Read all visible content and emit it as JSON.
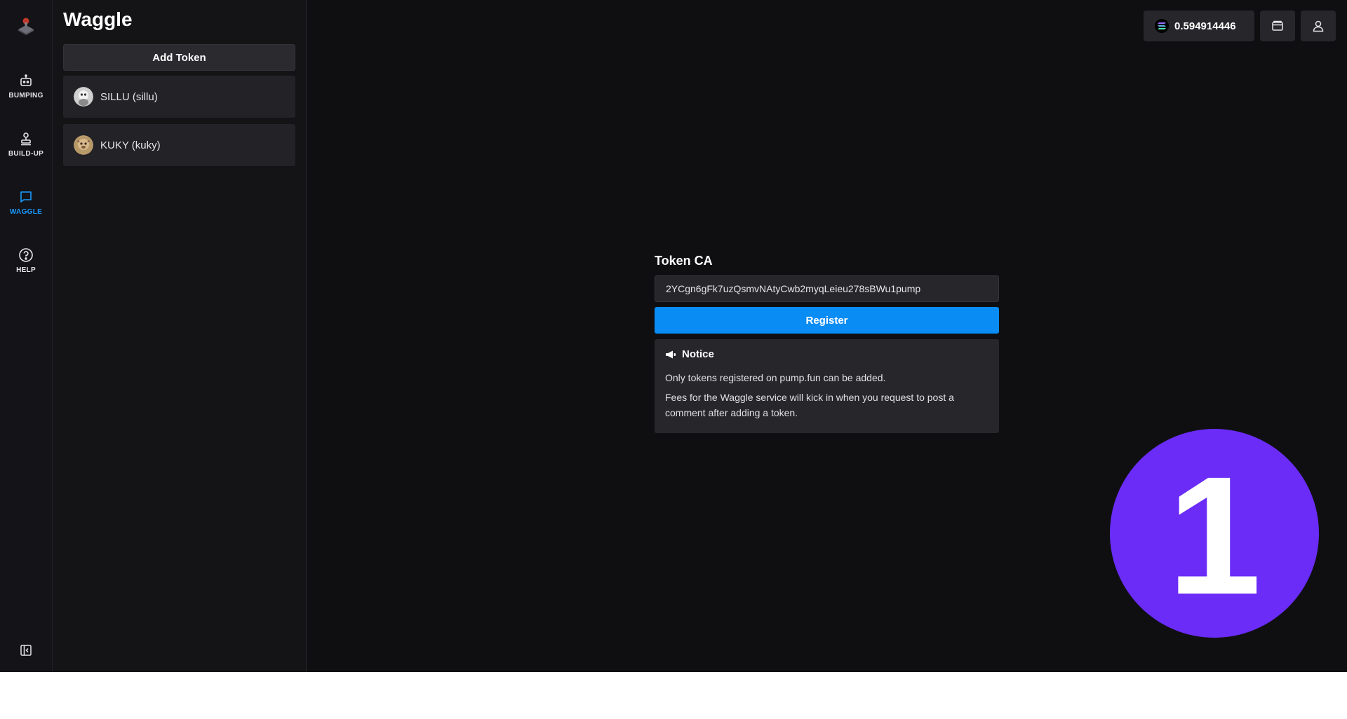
{
  "rail": {
    "items": [
      {
        "label": "BUMPING",
        "icon": "robot-icon"
      },
      {
        "label": "BUILD-UP",
        "icon": "stamp-icon"
      },
      {
        "label": "WAGGLE",
        "icon": "chat-icon",
        "active": true
      },
      {
        "label": "HELP",
        "icon": "help-circle-icon"
      }
    ]
  },
  "sidebar": {
    "title": "Waggle",
    "add_token_label": "Add Token",
    "tokens": [
      {
        "label": "SILLU (sillu)"
      },
      {
        "label": "KUKY (kuky)"
      }
    ]
  },
  "topbar": {
    "balance": "0.594914446"
  },
  "form": {
    "label": "Token CA",
    "ca_value": "2YCgn6gFk7uzQsmvNAtyCwb2myqLeieu278sBWu1pump",
    "register_label": "Register"
  },
  "notice": {
    "title": "Notice",
    "line1": "Only tokens registered on pump.fun can be added.",
    "line2": "Fees for the Waggle service will kick in when you request to post a comment after adding a token."
  },
  "badge": {
    "number": "1"
  },
  "colors": {
    "accent": "#0a8cf5",
    "active_nav": "#1a9bff",
    "badge": "#6a2cf6",
    "background": "#0f0f12"
  }
}
